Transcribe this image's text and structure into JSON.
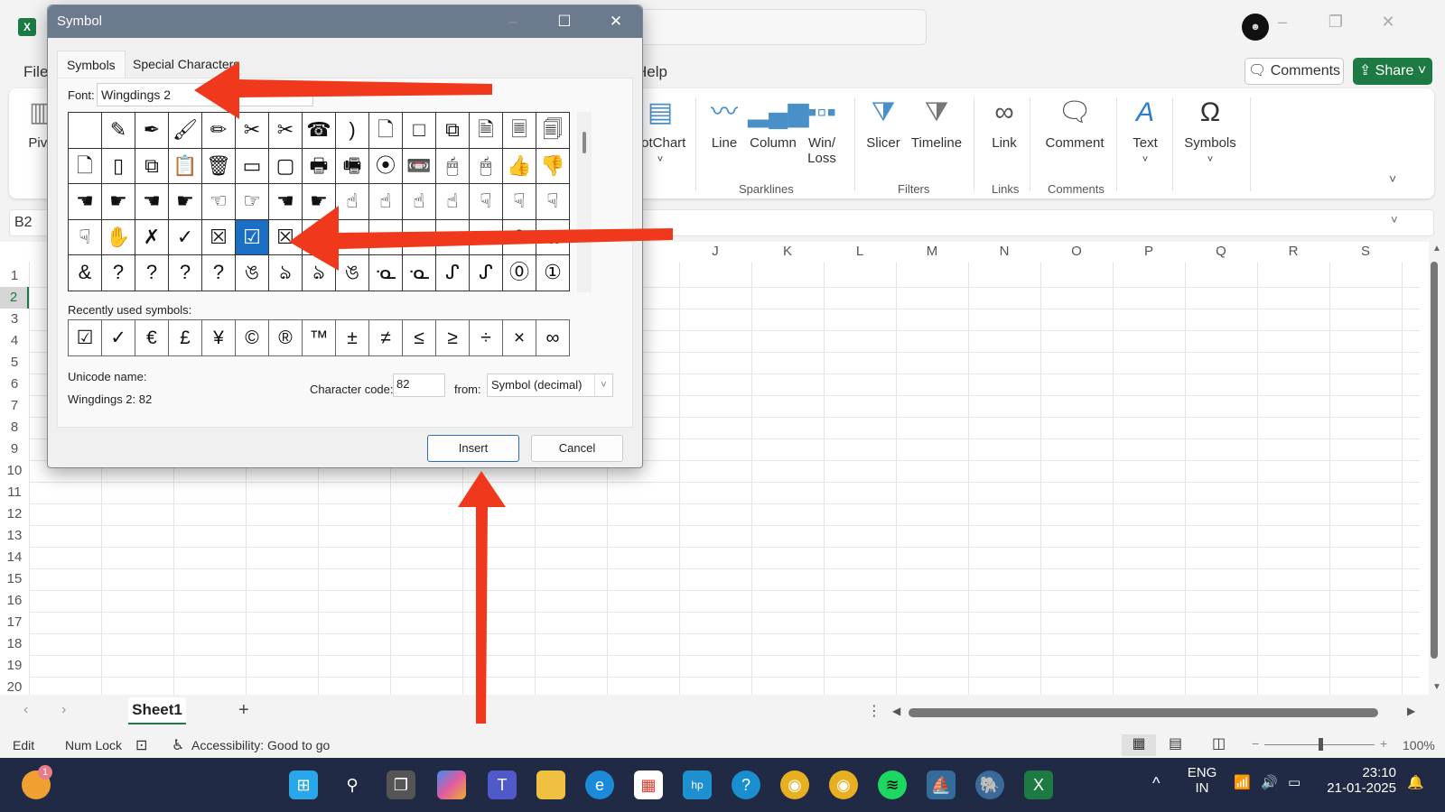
{
  "excel": {
    "menu": {
      "file": "File",
      "help": "Help"
    },
    "buttons": {
      "comments": "Comments",
      "share": "Share"
    },
    "ribbon": {
      "left_partial": "Pivo",
      "pivotchart": "votChart",
      "sparklines": [
        {
          "label": "Line"
        },
        {
          "label": "Column"
        },
        {
          "label": "Win/\nLoss",
          "line1": "Win/",
          "line2": "Loss"
        }
      ],
      "filters": [
        {
          "label": "Slicer"
        },
        {
          "label": "Timeline"
        }
      ],
      "links": [
        {
          "label": "Link"
        }
      ],
      "comments": [
        {
          "label": "Comment"
        }
      ],
      "text": "Text",
      "symbols": "Symbols",
      "groups": {
        "sparklines": "Sparklines",
        "filters": "Filters",
        "links": "Links",
        "comments": "Comments"
      }
    },
    "name_box": "B2",
    "columns": [
      "J",
      "K",
      "L",
      "M",
      "N",
      "O",
      "P",
      "Q",
      "R",
      "S"
    ],
    "rows": [
      "1",
      "2",
      "3",
      "4",
      "5",
      "6",
      "7",
      "8",
      "9",
      "10",
      "11",
      "12",
      "13",
      "14",
      "15",
      "16",
      "17",
      "18",
      "19",
      "20"
    ],
    "selected_row": "2",
    "sheet_tab": "Sheet1",
    "status": {
      "mode": "Edit",
      "numlock": "Num Lock",
      "accessibility": "Accessibility: Good to go",
      "zoom": "100%"
    }
  },
  "dialog": {
    "title": "Symbol",
    "tabs": [
      "Symbols",
      "Special Characters"
    ],
    "active_tab": "Symbols",
    "font_label": "Font:",
    "font_value": "Wingdings 2",
    "symbol_rows": [
      [
        " ",
        "✎",
        "✒",
        "🖌",
        "✏",
        "✂",
        "✂",
        "☎",
        ")",
        "🗋",
        "□",
        "⧉",
        "🗎",
        "🗏",
        "🗐"
      ],
      [
        "🗋",
        "▯",
        "⧉",
        "📋",
        "🗑",
        "▭",
        "▢",
        "🖶",
        "🖷",
        "⦿",
        "📼",
        "🖱",
        "🖱",
        "👍",
        "👎"
      ],
      [
        "☚",
        "☛",
        "☚",
        "☛",
        "☜",
        "☞",
        "☚",
        "☛",
        "☝",
        "☝",
        "☝",
        "☝",
        "☟",
        "☟",
        "☟"
      ],
      [
        "☟",
        "✋",
        "✗",
        "✓",
        "☒",
        "☑",
        "☒",
        "",
        "",
        "",
        "",
        "",
        "",
        "&",
        "a"
      ],
      [
        "&",
        "?",
        "?",
        "?",
        "?",
        "ঙ",
        "ঌ",
        "ঌ",
        "ঙ",
        "ᓋ",
        "ᓋ",
        "ᔑ",
        "ᔑ",
        "⓪",
        "①"
      ]
    ],
    "selected_symbol": {
      "row": 3,
      "col": 5
    },
    "recent_label": "Recently used symbols:",
    "recent_symbols": [
      "☑",
      "✓",
      "€",
      "£",
      "¥",
      "©",
      "®",
      "™",
      "±",
      "≠",
      "≤",
      "≥",
      "÷",
      "×",
      "∞"
    ],
    "unicode_name_label": "Unicode name:",
    "unicode_name_value": "Wingdings 2: 82",
    "char_code_label": "Character code:",
    "char_code_value": "82",
    "from_label": "from:",
    "from_value": "Symbol (decimal)",
    "insert_label": "Insert",
    "cancel_label": "Cancel"
  },
  "taskbar": {
    "notification_badge": "1",
    "lang_line1": "ENG",
    "lang_line2": "IN",
    "time": "23:10",
    "date": "21-01-2025"
  },
  "annotation": {
    "arrow_color": "#f0391c"
  },
  "colors": {
    "excel_green": "#1d7a43",
    "selection_blue": "#1a6fc4",
    "dialog_title": "#6b7a8c"
  }
}
